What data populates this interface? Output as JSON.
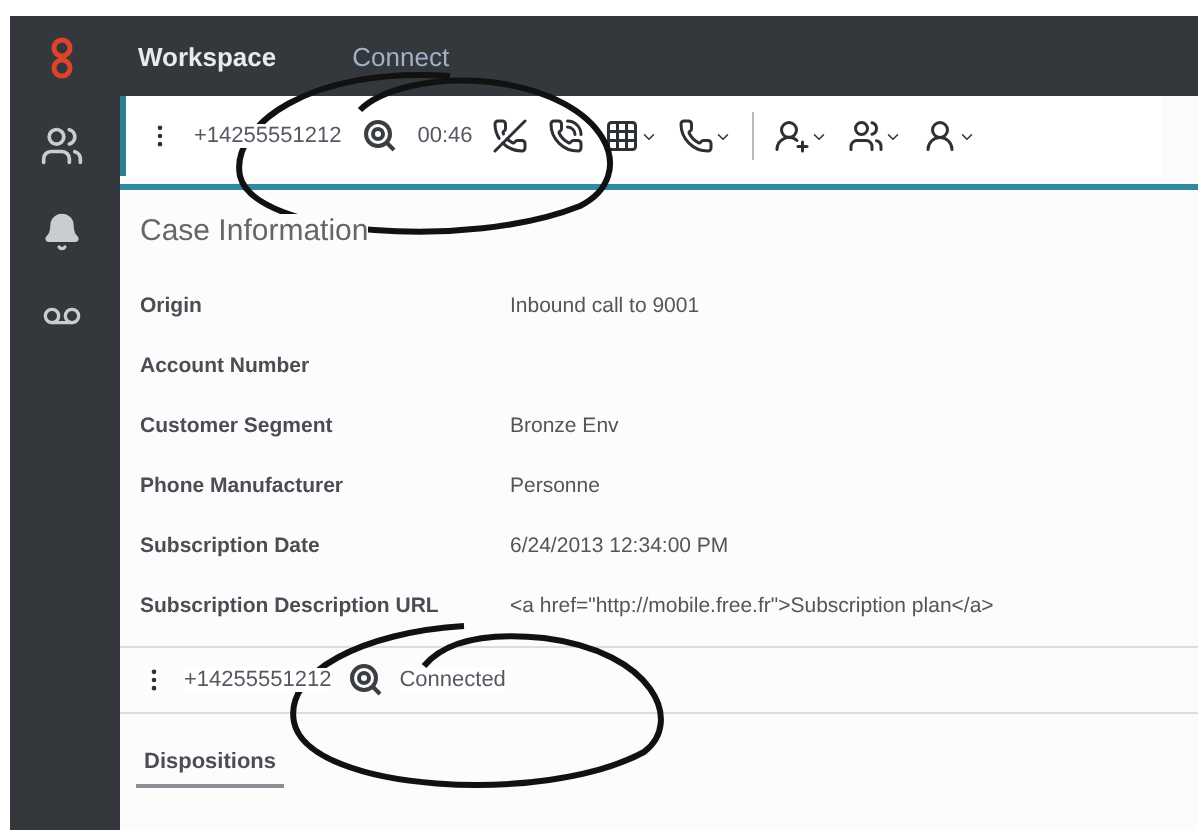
{
  "top_nav": [
    {
      "label": "Workspace",
      "selected": true
    },
    {
      "label": "Connect",
      "selected": false
    }
  ],
  "active_interaction": {
    "phone": "+14255551212",
    "timer": "00:46"
  },
  "case_information": {
    "title": "Case Information",
    "fields": [
      {
        "label": "Origin",
        "value": "Inbound call to 9001"
      },
      {
        "label": "Account Number"
      },
      {
        "label": "Customer Segment",
        "value": "Bronze Env"
      },
      {
        "label": "Phone Manufacturer",
        "value": "Personne"
      },
      {
        "label": "Subscription Date",
        "value": "6/24/2013 12:34:00 PM"
      },
      {
        "label": "Subscription Description URL",
        "value": "<a href=\"http://mobile.free.fr\">Subscription plan</a>"
      }
    ]
  },
  "second_interaction": {
    "phone": "+14255551212",
    "status": "Connected"
  },
  "tabs": [
    {
      "label": "Dispositions",
      "selected": true
    }
  ]
}
